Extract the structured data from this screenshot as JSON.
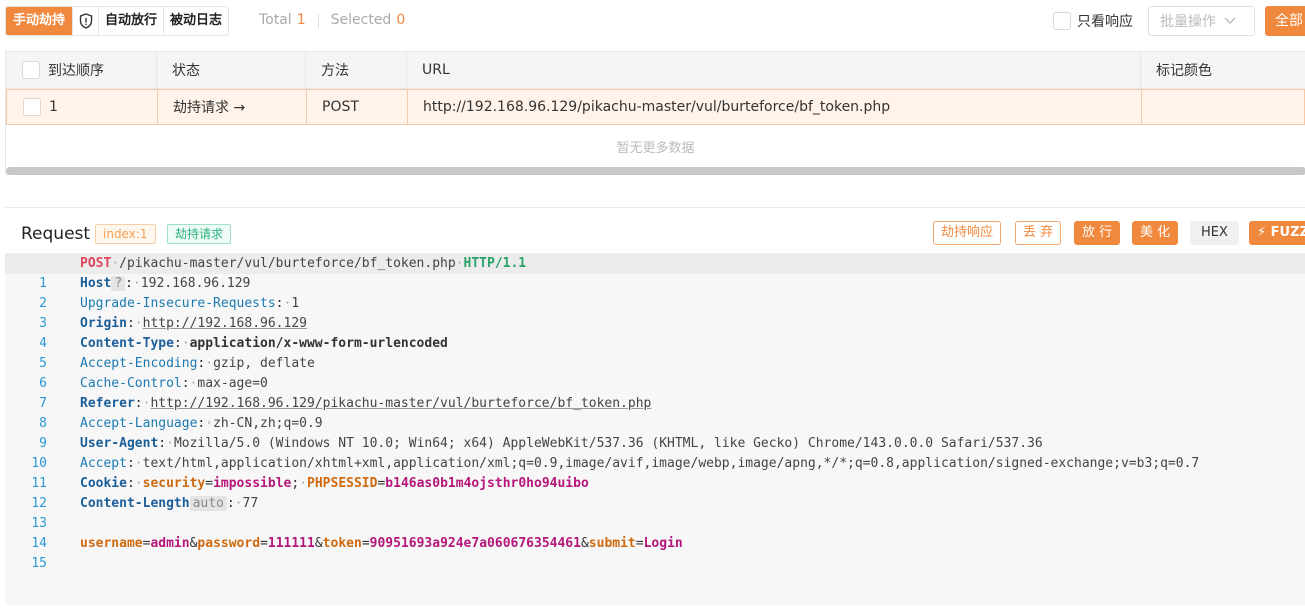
{
  "toolbar": {
    "manual_hijack": "手动劫持",
    "auto_release": "自动放行",
    "passive_log": "被动日志",
    "total_label": "Total",
    "total_count": "1",
    "selected_label": "Selected",
    "selected_count": "0",
    "only_response": "只看响应",
    "batch_ops": "批量操作",
    "all": "全部"
  },
  "table": {
    "headers": [
      "到达顺序",
      "状态",
      "方法",
      "URL",
      "标记颜色"
    ],
    "rows": [
      {
        "order": "1",
        "status": "劫持请求 →",
        "method": "POST",
        "url": "http://192.168.96.129/pikachu-master/vul/burteforce/bf_token.php",
        "color": ""
      }
    ],
    "empty_text": "暂无更多数据"
  },
  "request": {
    "title": "Request",
    "index_tag": "index:1",
    "state_tag": "劫持请求",
    "buttons": {
      "hijack_response": "劫持响应",
      "drop": "丢 弃",
      "forward": "放 行",
      "beautify": "美 化",
      "hex": "HEX",
      "fuzz": "⚡ FUZZ"
    },
    "lines": {
      "l1": {
        "method": "POST",
        "path": "/pikachu-master/vul/burteforce/bf_token.php",
        "proto": "HTTP/1.1"
      },
      "l2": {
        "key": "Host",
        "hint": "?",
        "val": "192.168.96.129"
      },
      "l3": {
        "key": "Upgrade-Insecure-Requests",
        "val": "1"
      },
      "l4": {
        "key": "Origin",
        "val": "http://192.168.96.129"
      },
      "l5": {
        "key": "Content-Type",
        "val": "application/x-www-form-urlencoded"
      },
      "l6": {
        "key": "Accept-Encoding",
        "val": "gzip, deflate"
      },
      "l7": {
        "key": "Cache-Control",
        "val": "max-age=0"
      },
      "l8": {
        "key": "Referer",
        "val": "http://192.168.96.129/pikachu-master/vul/burteforce/bf_token.php"
      },
      "l9": {
        "key": "Accept-Language",
        "val": "zh-CN,zh;q=0.9"
      },
      "l10": {
        "key": "User-Agent",
        "val": "Mozilla/5.0 (Windows NT 10.0; Win64; x64) AppleWebKit/537.36 (KHTML, like Gecko) Chrome/143.0.0.0 Safari/537.36"
      },
      "l11": {
        "key": "Accept",
        "val": "text/html,application/xhtml+xml,application/xml;q=0.9,image/avif,image/webp,image/apng,*/*;q=0.8,application/signed-exchange;v=b3;q=0.7"
      },
      "l12": {
        "key": "Cookie",
        "c1k": "security",
        "c1v": "impossible",
        "c2k": "PHPSESSID",
        "c2v": "b146as0b1m4ojsthr0ho94uibo"
      },
      "l13": {
        "key": "Content-Length",
        "hint": "auto",
        "val": "77"
      },
      "l15": {
        "p1k": "username",
        "p1v": "admin",
        "p2k": "password",
        "p2v": "111111",
        "p3k": "token",
        "p3v": "90951693a924e7a060676354461",
        "p4k": "submit",
        "p4v": "Login"
      }
    }
  },
  "colors": {
    "accent": "#f0883e",
    "row_highlight": "#fff3ea",
    "link_num": "#2a9ad5"
  }
}
